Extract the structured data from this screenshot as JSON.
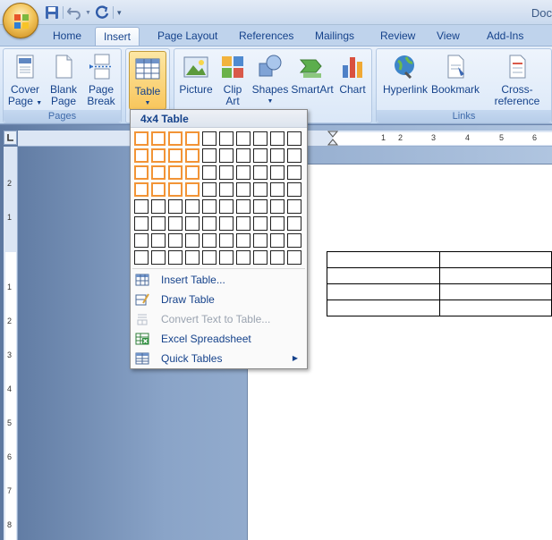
{
  "window": {
    "title": "Doc"
  },
  "tabs": [
    "Home",
    "Insert",
    "Page Layout",
    "References",
    "Mailings",
    "Review",
    "View",
    "Add-Ins"
  ],
  "active_tab": "Insert",
  "ribbon": {
    "pages": {
      "label": "Pages",
      "cover_page": [
        "Cover",
        "Page"
      ],
      "blank_page": [
        "Blank",
        "Page"
      ],
      "page_break": [
        "Page",
        "Break"
      ]
    },
    "tables": {
      "table": "Table"
    },
    "illustrations": {
      "picture": "Picture",
      "clip_art": [
        "Clip",
        "Art"
      ],
      "shapes": "Shapes",
      "smartart": "SmartArt",
      "chart": "Chart"
    },
    "links": {
      "label": "Links",
      "hyperlink": "Hyperlink",
      "bookmark": "Bookmark",
      "cross_reference": "Cross-reference"
    }
  },
  "table_menu": {
    "header": "4x4 Table",
    "grid": {
      "columns": 10,
      "rows": 8,
      "highlighted_columns": 4,
      "highlighted_rows": 4,
      "highlight_color": "#f29436"
    },
    "items": [
      {
        "label": "Insert Table...",
        "icon": "insert-table-icon",
        "enabled": true
      },
      {
        "label": "Draw Table",
        "icon": "draw-table-icon",
        "enabled": true
      },
      {
        "label": "Convert Text to Table...",
        "icon": "convert-text-icon",
        "enabled": false
      },
      {
        "label": "Excel Spreadsheet",
        "icon": "excel-icon",
        "enabled": true
      },
      {
        "label": "Quick Tables",
        "icon": "quick-tables-icon",
        "enabled": true,
        "submenu": true
      }
    ]
  },
  "ruler": {
    "horizontal_labels": [
      "1",
      "2",
      "3",
      "4",
      "5",
      "6"
    ],
    "vertical_labels": [
      "2",
      "1",
      "1",
      "2",
      "3",
      "4",
      "5",
      "6",
      "7",
      "8"
    ]
  },
  "document_table": {
    "rows": 4,
    "columns": 2
  },
  "colors": {
    "ribbon_text": "#15428b",
    "pressed_button": "#f8c65c",
    "highlight": "#f29436"
  }
}
